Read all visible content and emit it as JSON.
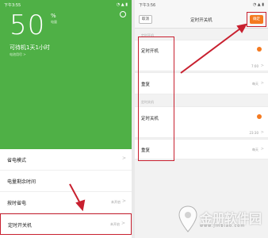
{
  "left": {
    "status_time": "下午3:55",
    "status_right": "◔ ▲ ▮",
    "battery_percent": "50",
    "battery_unit": "%",
    "battery_unit_sub": "电量",
    "standby_text": "可待机1天1小时",
    "standby_detail": "电池用尽 >",
    "list": [
      {
        "label": "省电模式",
        "value": "",
        "chev": ">"
      },
      {
        "label": "电量剩余时间",
        "value": "",
        "chev": ""
      },
      {
        "label": "按时省电",
        "value": "未开启",
        "chev": ">"
      },
      {
        "label": "定时开关机",
        "value": "未开启",
        "chev": ">"
      }
    ]
  },
  "right": {
    "status_time": "下午3:56",
    "status_right": "◔ ▲ ▮",
    "back_label": "取消",
    "title": "定时开关机",
    "save_label": "确定",
    "section_on": "定时开机",
    "on_toggle_label": "定时开机",
    "on_time_value": "7:00",
    "on_repeat_label": "重复",
    "on_repeat_value": "每天",
    "section_off": "定时关机",
    "off_toggle_label": "定时关机",
    "off_time_value": "23:30",
    "off_repeat_label": "重复",
    "off_repeat_value": "每天",
    "chev": ">"
  },
  "watermark": {
    "text": "金册软件园",
    "url": "www.jinbiao.com"
  },
  "colors": {
    "battery_green": "#4fb046",
    "accent_orange": "#f47a20",
    "highlight_red": "#c8202f"
  }
}
